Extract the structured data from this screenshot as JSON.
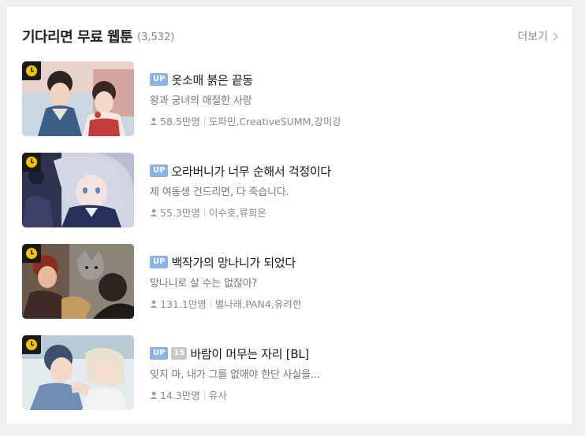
{
  "header": {
    "title": "기다리면 무료 웹툰",
    "count": "(3,532)",
    "more_label": "더보기"
  },
  "colors": {
    "up_badge": "#8ab3e6",
    "age_badge": "#c8c8c8",
    "wait_badge_bg": "#1a1a1a",
    "wait_badge_icon": "#f5c400"
  },
  "items": [
    {
      "badge": "UP",
      "title": "옷소매 붉은 끝동",
      "description": "왕과 궁녀의 애절한 사랑",
      "views": "58.5만명",
      "authors": "도파민,CreativeSUMM,강미강"
    },
    {
      "badge": "UP",
      "title": "오라버니가 너무 순해서 걱정이다",
      "description": "제 여동생 건드리면, 다 죽습니다.",
      "views": "55.3만명",
      "authors": "이수호,류희온"
    },
    {
      "badge": "UP",
      "title": "백작가의 망나니가 되었다",
      "description": "망나니로 살 수는 없잖아?",
      "views": "131.1만명",
      "authors": "별나래,PAN4,유려한"
    },
    {
      "badge": "UP",
      "age_badge": "15",
      "title": "바람이 머무는 자리 [BL]",
      "description": "잊지 마, 내가 그를 없애야 한단 사실을...",
      "views": "14.3만명",
      "authors": "유사"
    }
  ]
}
